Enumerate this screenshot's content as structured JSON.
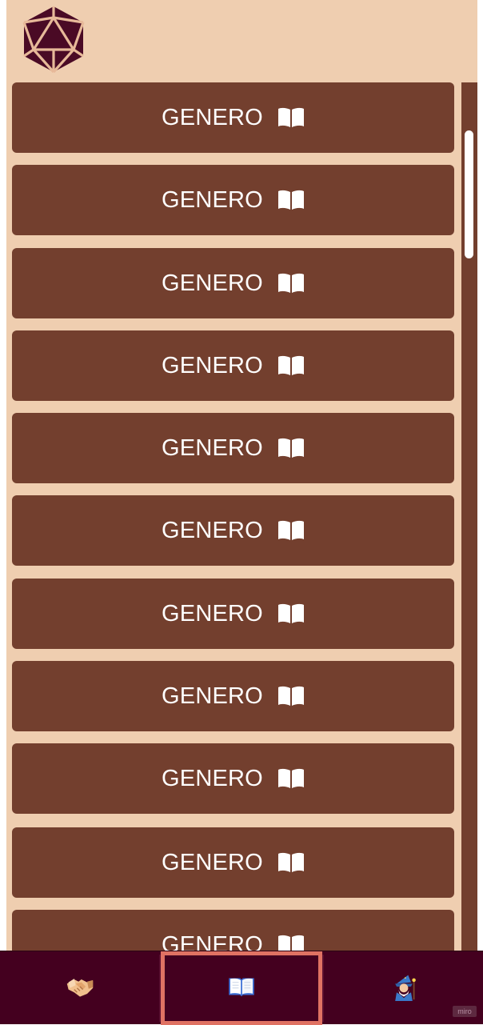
{
  "header": {
    "logo_icon": "d20-dice-icon"
  },
  "genres": [
    {
      "label": "GENERO",
      "icon": "open-book-icon"
    },
    {
      "label": "GENERO",
      "icon": "open-book-icon"
    },
    {
      "label": "GENERO",
      "icon": "open-book-icon"
    },
    {
      "label": "GENERO",
      "icon": "open-book-icon"
    },
    {
      "label": "GENERO",
      "icon": "open-book-icon"
    },
    {
      "label": "GENERO",
      "icon": "open-book-icon"
    },
    {
      "label": "GENERO",
      "icon": "open-book-icon"
    },
    {
      "label": "GENERO",
      "icon": "open-book-icon"
    },
    {
      "label": "GENERO",
      "icon": "open-book-icon"
    },
    {
      "label": "GENERO",
      "icon": "open-book-icon"
    },
    {
      "label": "GENERO",
      "icon": "open-book-icon"
    }
  ],
  "bottom_nav": {
    "items": [
      {
        "icon": "handshake-icon",
        "active": false
      },
      {
        "icon": "open-book-icon",
        "active": true
      },
      {
        "icon": "wizard-icon",
        "active": false
      }
    ]
  },
  "watermark": "miro",
  "colors": {
    "background": "#efceb0",
    "button": "#733f2e",
    "nav": "#44001f",
    "active_border": "#e07263",
    "logo": "#4a0a25"
  }
}
